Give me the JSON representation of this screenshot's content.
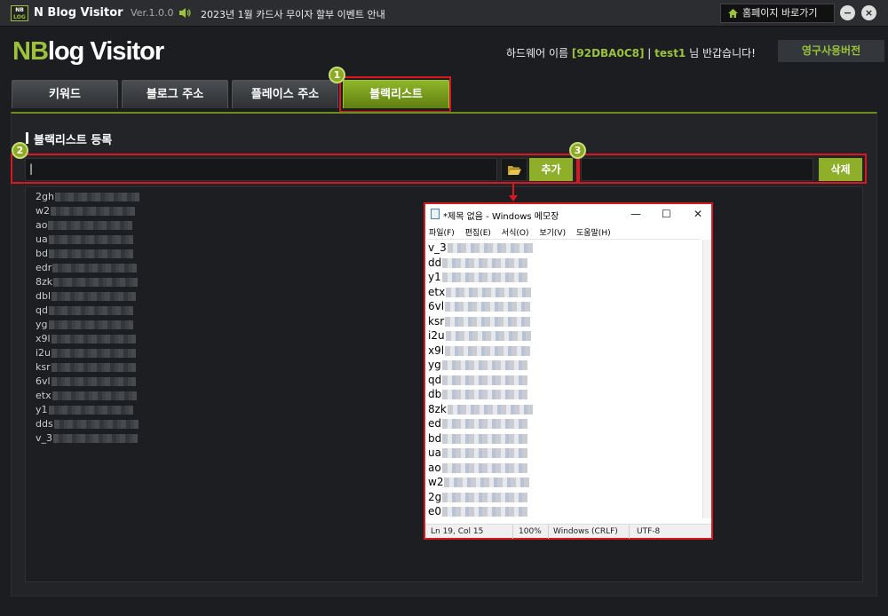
{
  "titlebar": {
    "logo_top": "NB",
    "logo_bottom": "LOG",
    "app_name": "N Blog Visitor",
    "version": "Ver.1.0.0",
    "notice": "2023년 1월 카드사 무이자 할부 이벤트 안내",
    "home_label": "홈페이지 바로가기",
    "minimize": "−",
    "close": "×"
  },
  "header": {
    "brand_nb": "NB",
    "brand_rest": "log Visitor",
    "user_prefix": "하드웨어 이름",
    "hardware_id": "[92DBA0C8]",
    "divider": "|",
    "username": "test1",
    "greeting": "님 반갑습니다!",
    "license": "영구사용버전"
  },
  "tabs": [
    {
      "label": "키워드"
    },
    {
      "label": "블로그 주소"
    },
    {
      "label": "플레이스 주소"
    },
    {
      "label": "블랙리스트"
    }
  ],
  "markers": [
    "1",
    "2",
    "3"
  ],
  "section": {
    "title": "블랙리스트 등록",
    "input_value": "|",
    "add_label": "추가",
    "delete_label": "삭제"
  },
  "blacklist": [
    "2gh",
    "w2",
    "ao",
    "ua",
    "bd",
    "edr",
    "8zk",
    "dbl",
    "qd",
    "yg",
    "x9l",
    "i2u",
    "ksr",
    "6vl",
    "etx",
    "y1",
    "dds",
    "v_3"
  ],
  "notepad": {
    "title": "*제목 없음 - Windows 메모장",
    "menu": [
      "파일(F)",
      "편집(E)",
      "서식(O)",
      "보기(V)",
      "도움말(H)"
    ],
    "lines": [
      "v_3",
      "dd",
      "y1",
      "etx",
      "6vl",
      "ksr",
      "i2u",
      "x9l",
      "yg",
      "qd",
      "db",
      "8zk",
      "ed",
      "bd",
      "ua",
      "ao",
      "w2",
      "2g",
      "e0"
    ],
    "status": {
      "position": "Ln 19, Col 15",
      "zoom": "100%",
      "eol": "Windows (CRLF)",
      "encoding": "UTF-8"
    }
  },
  "colors": {
    "accent": "#9bc23a",
    "highlight_box": "#d9171e",
    "background": "#1b1d20"
  }
}
